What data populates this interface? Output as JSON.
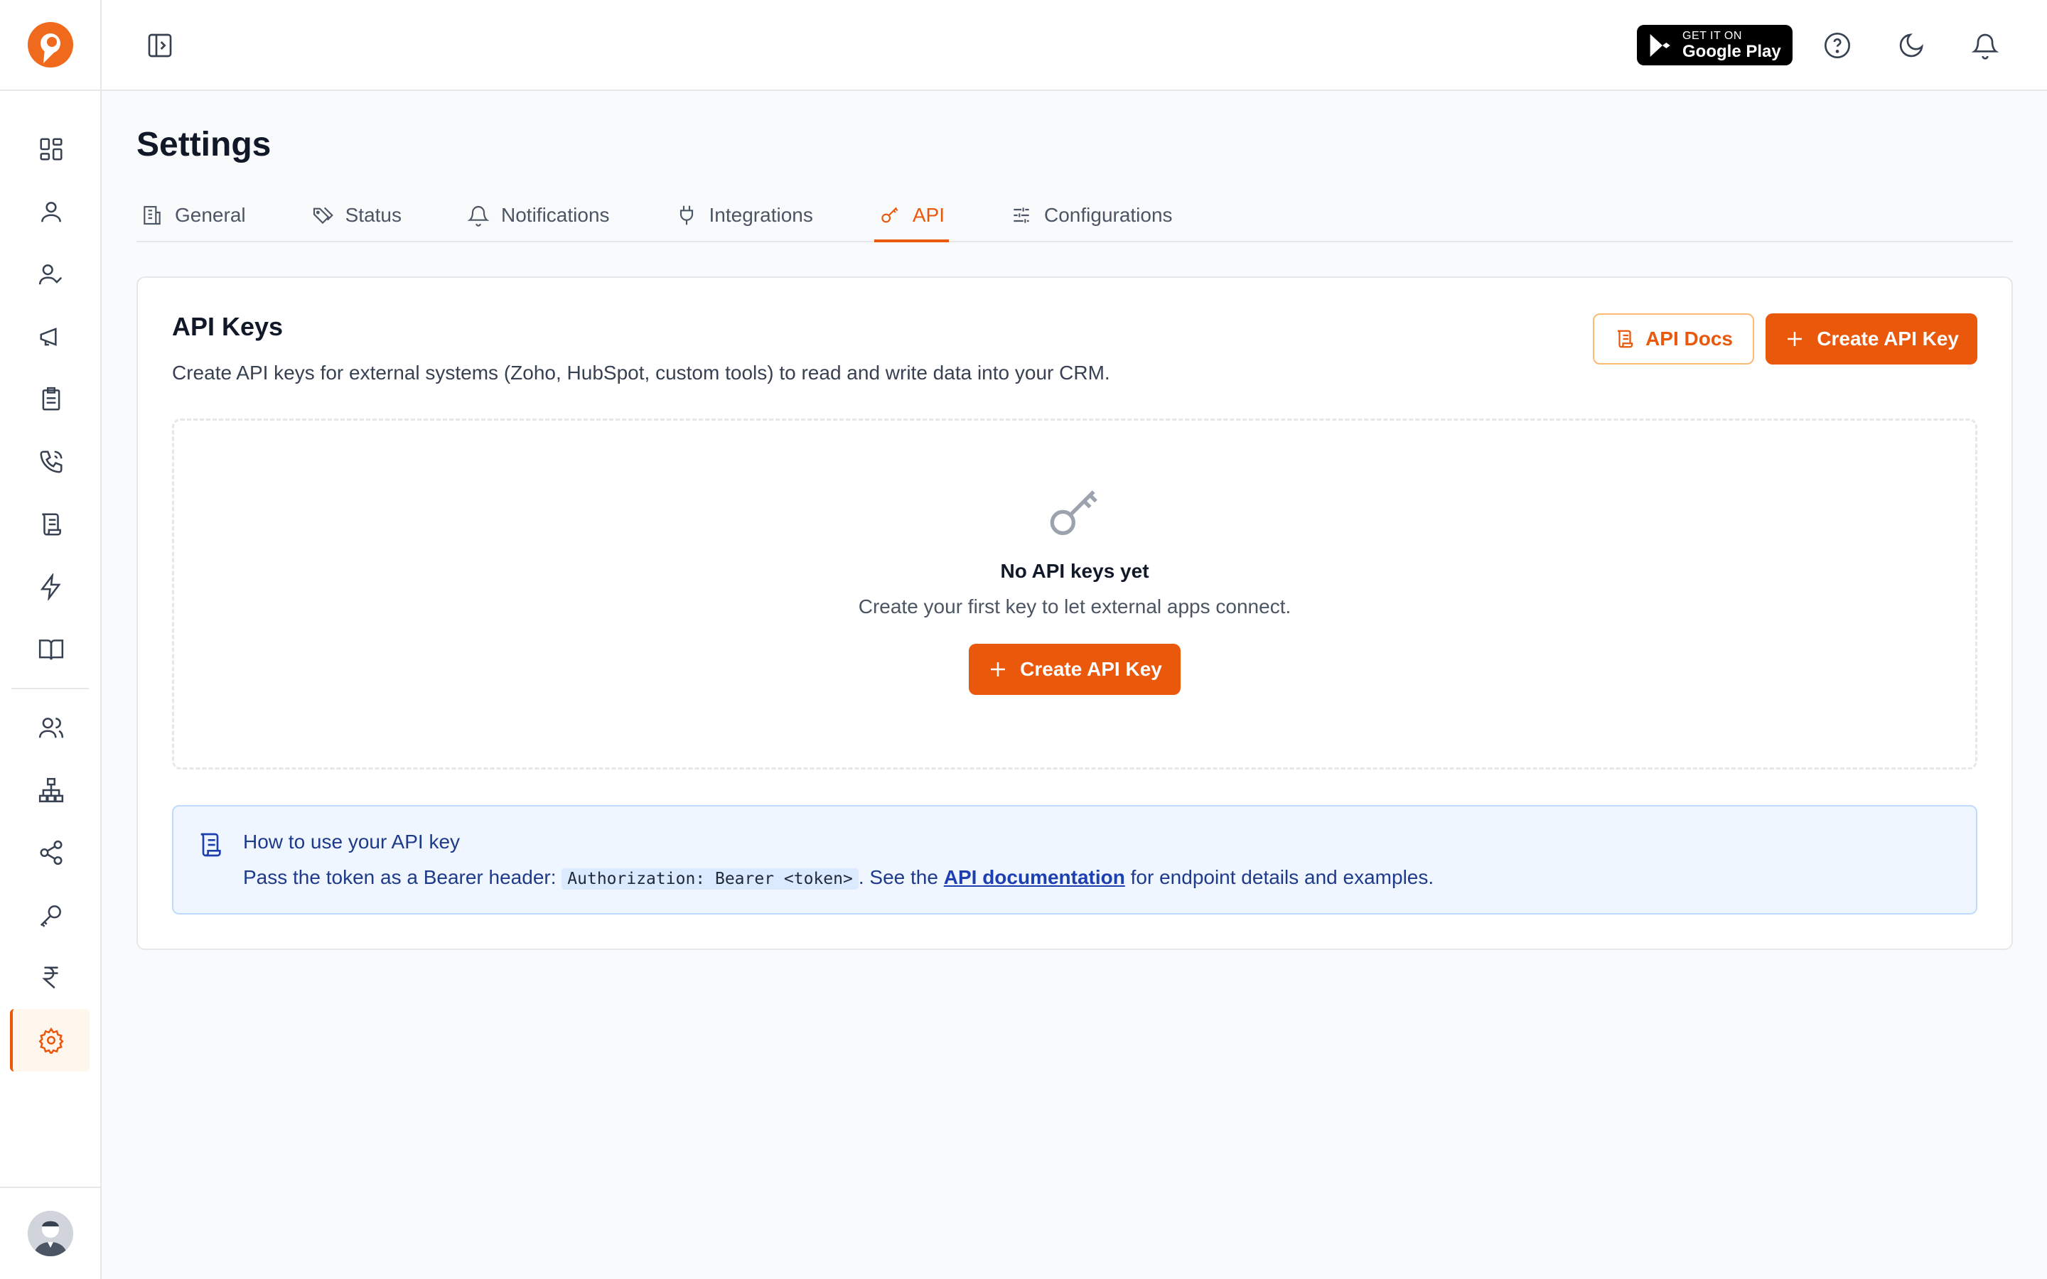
{
  "header": {
    "google_play_small": "GET IT ON",
    "google_play_big": "Google Play"
  },
  "page": {
    "title": "Settings"
  },
  "tabs": [
    {
      "label": "General"
    },
    {
      "label": "Status"
    },
    {
      "label": "Notifications"
    },
    {
      "label": "Integrations"
    },
    {
      "label": "API"
    },
    {
      "label": "Configurations"
    }
  ],
  "active_tab": "API",
  "card": {
    "title": "API Keys",
    "description": "Create API keys for external systems (Zoho, HubSpot, custom tools) to read and write data into your CRM.",
    "docs_label": "API Docs",
    "create_label": "Create API Key"
  },
  "empty": {
    "title": "No API keys yet",
    "subtitle": "Create your first key to let external apps connect.",
    "button_label": "Create API Key"
  },
  "info": {
    "title": "How to use your API key",
    "body_prefix": "Pass the token as a Bearer header:",
    "code": "Authorization: Bearer <token>",
    "body_mid": ". See the",
    "link_text": "API documentation",
    "body_suffix": "for endpoint details and examples."
  },
  "colors": {
    "accent": "#ea580c",
    "info_bg": "#eff6ff"
  }
}
